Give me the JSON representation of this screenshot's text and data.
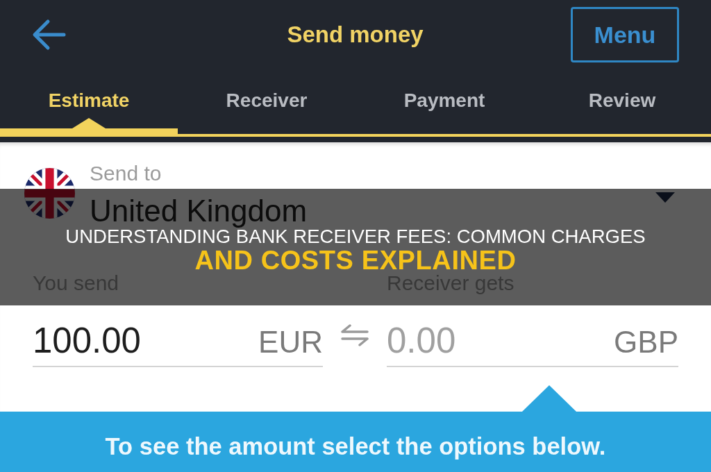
{
  "header": {
    "title": "Send money",
    "menu_button": "Menu"
  },
  "tabs": [
    {
      "label": "Estimate",
      "selected": true
    },
    {
      "label": "Receiver",
      "selected": false
    },
    {
      "label": "Payment",
      "selected": false
    },
    {
      "label": "Review",
      "selected": false
    }
  ],
  "destination": {
    "label": "Send to",
    "country": "United Kingdom"
  },
  "amounts": [
    {
      "label": "You send",
      "value": "100.00",
      "currency": "EUR"
    },
    {
      "label": "Receiver gets",
      "placeholder": "0.00",
      "currency": "GBP"
    }
  ],
  "notice": "To see the amount select the options below.",
  "banner": {
    "lines": [
      {
        "kind": "headline",
        "text": "UNDERSTANDING BANK RECEIVER FEES: COMMON CHARGES"
      },
      {
        "kind": "highlight",
        "text": "AND COSTS EXPLAINED"
      }
    ]
  }
}
